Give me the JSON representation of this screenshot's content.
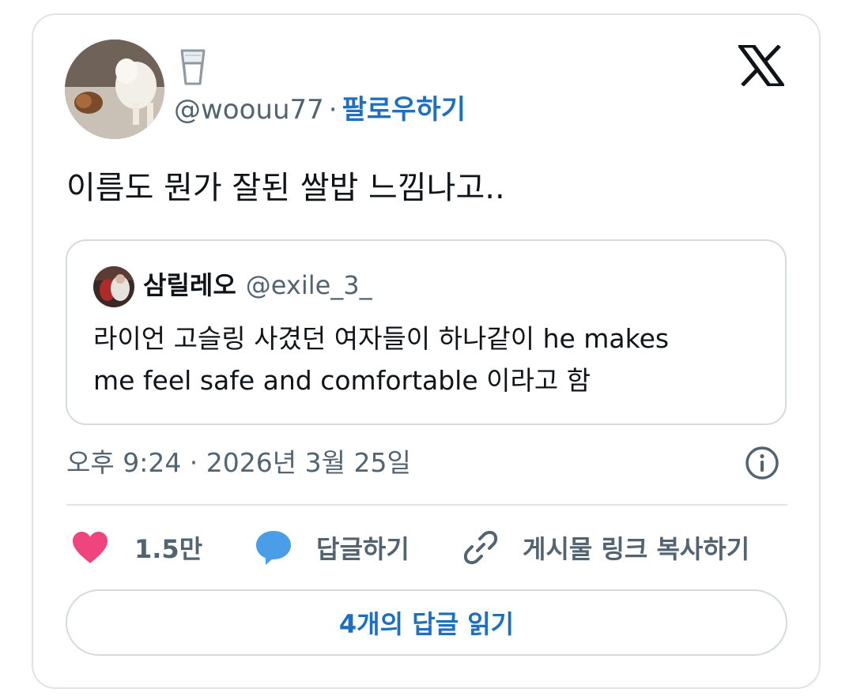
{
  "tweet": {
    "display_name_icon": "glass-of-milk-emoji",
    "handle": "@woouu77",
    "separator": "·",
    "follow_label": "팔로우하기",
    "text": "이름도 뭔가 잘된 쌀밥 느낌나고..",
    "quote": {
      "name": "삼릴레오",
      "handle": "@exile_3_",
      "text_lines": [
        "라이언 고슬링 사겼던 여자들이 하나같이 he makes",
        "me feel safe and comfortable 이라고 함"
      ]
    },
    "timestamp": "오후 9:24 · 2026년 3월 25일",
    "actions": {
      "like_count": "1.5만",
      "reply_label": "답글하기",
      "copy_link_label": "게시물 링크 복사하기"
    },
    "read_replies_label": "4개의 답글 읽기"
  },
  "colors": {
    "accent": "#1d6fc2",
    "heart": "#f0447e",
    "reply_bubble": "#4a9ee8",
    "secondary_text": "#536471"
  },
  "icons": [
    "x-logo-icon",
    "info-icon",
    "heart-icon",
    "speech-bubble-icon",
    "link-icon"
  ]
}
